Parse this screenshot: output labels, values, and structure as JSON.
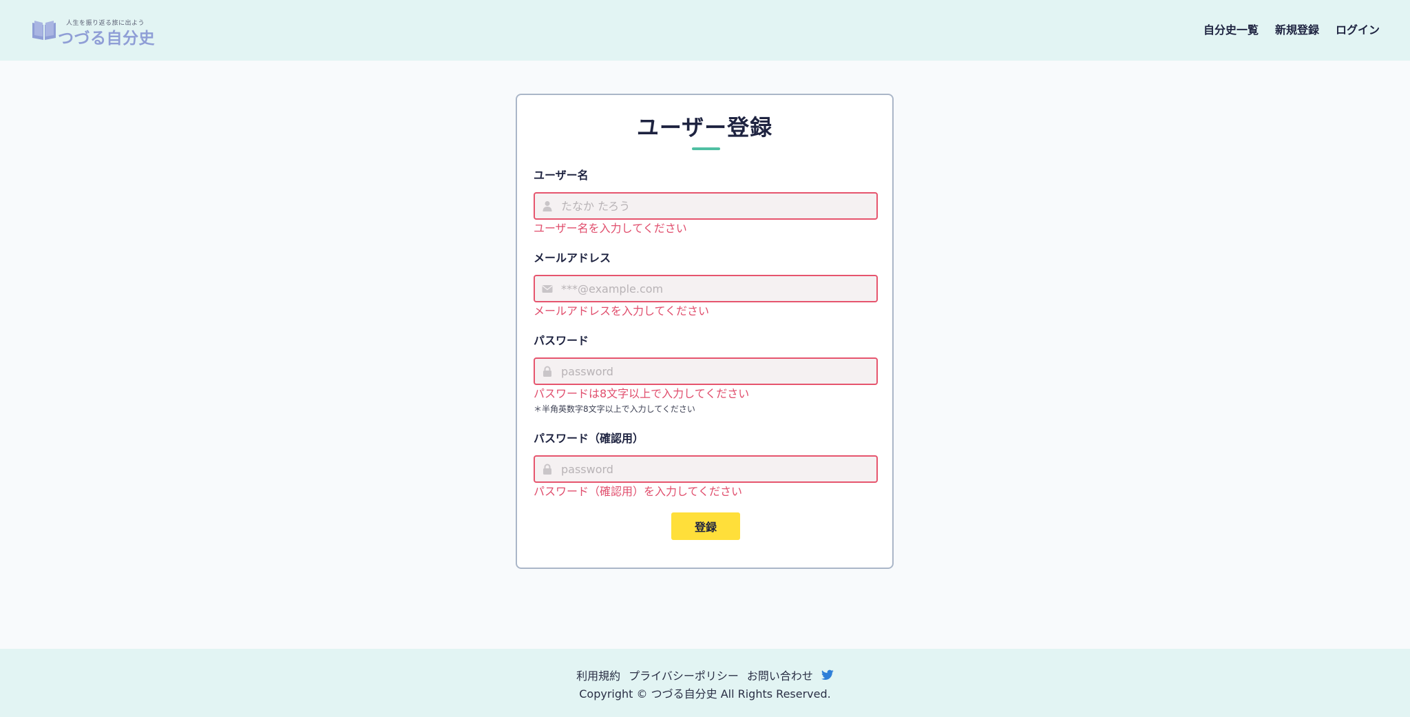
{
  "header": {
    "logo": {
      "tagline": "人生を振り返る旅に出よう",
      "name": "つづる自分史"
    },
    "nav": [
      {
        "label": "自分史一覧"
      },
      {
        "label": "新規登録"
      },
      {
        "label": "ログイン"
      }
    ]
  },
  "form": {
    "title": "ユーザー登録",
    "fields": [
      {
        "label": "ユーザー名",
        "value": "",
        "placeholder": "たなか たろう",
        "icon": "user-icon",
        "error": "ユーザー名を入力してください"
      },
      {
        "label": "メールアドレス",
        "value": "",
        "placeholder": "***@example.com",
        "icon": "envelope-icon",
        "error": "メールアドレスを入力してください"
      },
      {
        "label": "パスワード",
        "value": "",
        "placeholder": "password",
        "icon": "lock-icon",
        "error": "パスワードは8文字以上で入力してください",
        "hint": "＊半角英数字8文字以上で入力してください"
      },
      {
        "label": "パスワード（確認用）",
        "value": "",
        "placeholder": "password",
        "icon": "lock-icon",
        "error": "パスワード（確認用）を入力してください"
      }
    ],
    "submit_label": "登録"
  },
  "footer": {
    "links": [
      {
        "label": "利用規約"
      },
      {
        "label": "プライバシーポリシー"
      },
      {
        "label": "お問い合わせ"
      }
    ],
    "social_icon": "twitter-icon",
    "copyright": "Copyright © つづる自分史 All Rights Reserved."
  },
  "colors": {
    "header_bg": "#e2f4f3",
    "page_bg": "#f8fafc",
    "accent": "#4fbfa2",
    "error": "#e04d6c",
    "button": "#ffdf3a",
    "logo": "#8f9ed6",
    "twitter": "#2f7fd8"
  }
}
